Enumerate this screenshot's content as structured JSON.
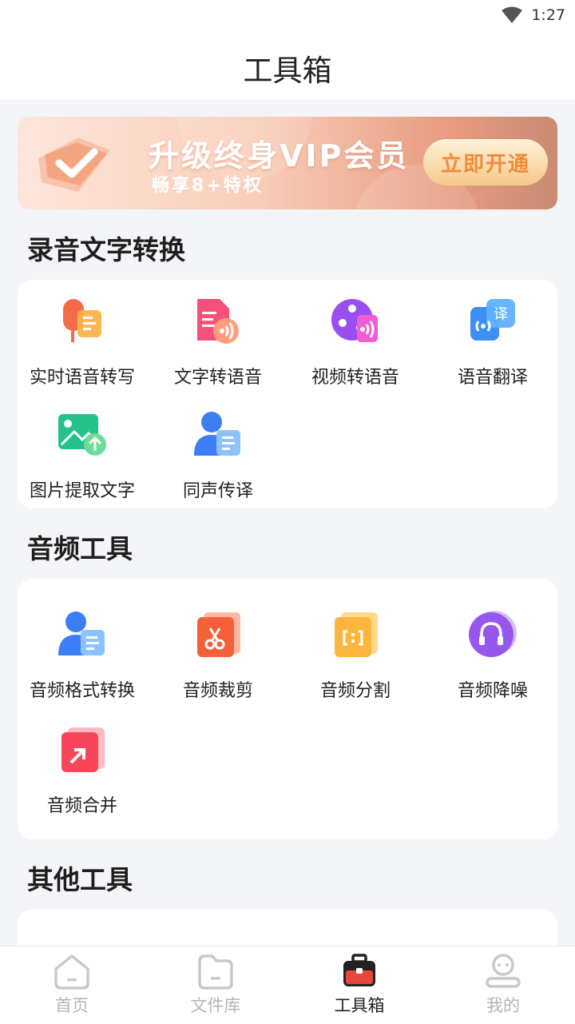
{
  "status_bar": {
    "time": "1:27",
    "wifi_icon": "wifi-icon"
  },
  "header": {
    "title": "工具箱"
  },
  "banner": {
    "title": "升级终身VIP会员",
    "subtitle": "畅享8+特权",
    "button_label": "立即开通",
    "colors": {
      "start": "#fde6db",
      "end": "#c98a73",
      "button_text": "#f18b3a"
    }
  },
  "sections": {
    "speech": {
      "title": "录音文字转换",
      "items": [
        {
          "label": "实时语音转写",
          "icon": "microphone-text-icon"
        },
        {
          "label": "文字转语音",
          "icon": "document-sound-icon"
        },
        {
          "label": "视频转语音",
          "icon": "video-reel-sound-icon"
        },
        {
          "label": "语音翻译",
          "icon": "speech-translate-icon"
        },
        {
          "label": "图片提取文字",
          "icon": "image-upload-icon"
        },
        {
          "label": "同声传译",
          "icon": "person-document-icon"
        }
      ]
    },
    "audio": {
      "title": "音频工具",
      "items": [
        {
          "label": "音频格式转换",
          "icon": "person-document-icon"
        },
        {
          "label": "音频裁剪",
          "icon": "scissors-icon"
        },
        {
          "label": "音频分割",
          "icon": "split-file-icon"
        },
        {
          "label": "音频降噪",
          "icon": "headphones-icon"
        },
        {
          "label": "音频合并",
          "icon": "merge-file-icon"
        }
      ]
    },
    "other": {
      "title": "其他工具"
    }
  },
  "bottom_nav": {
    "items": [
      {
        "label": "首页",
        "icon": "home-icon",
        "active": false
      },
      {
        "label": "文件库",
        "icon": "folder-icon",
        "active": false
      },
      {
        "label": "工具箱",
        "icon": "toolbox-icon",
        "active": true
      },
      {
        "label": "我的",
        "icon": "profile-icon",
        "active": false
      }
    ],
    "colors": {
      "active": "#222222",
      "inactive": "#b5b5b5",
      "accent": "#e8473c"
    }
  }
}
